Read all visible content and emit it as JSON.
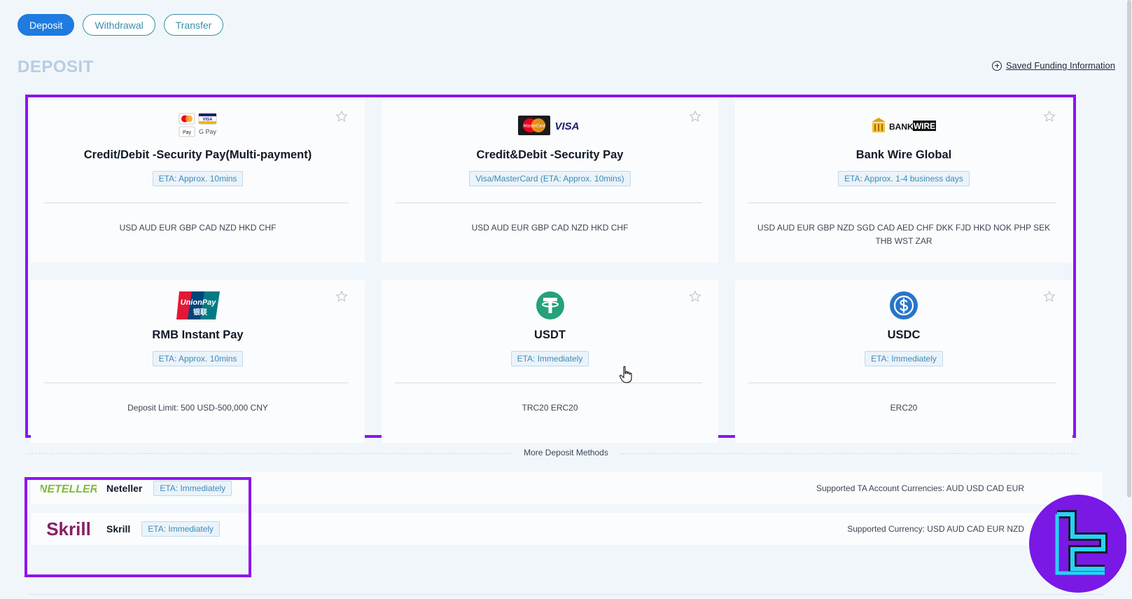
{
  "tabs": [
    {
      "label": "Deposit",
      "active": true
    },
    {
      "label": "Withdrawal",
      "active": false
    },
    {
      "label": "Transfer",
      "active": false
    }
  ],
  "page_title": "DEPOSIT",
  "saved_link": "Saved Funding Information",
  "cards": [
    {
      "name": "Credit/Debit -Security Pay(Multi-payment)",
      "eta": "ETA: Approx. 10mins",
      "currencies": "USD AUD EUR GBP CAD NZD HKD CHF",
      "logo_icon": "multi-payment-logo-icon",
      "logo_text": [
        "VISA",
        "Pay",
        "G Pay"
      ]
    },
    {
      "name": "Credit&Debit -Security Pay",
      "eta": "Visa/MasterCard (ETA: Approx. 10mins)",
      "currencies": "USD AUD EUR GBP CAD NZD HKD CHF",
      "logo_icon": "mastercard-visa-logo-icon",
      "logo_text": [
        "MasterCard",
        "VISA"
      ]
    },
    {
      "name": "Bank Wire Global",
      "eta": "ETA: Approx. 1-4 business days",
      "currencies": "USD AUD EUR GBP NZD SGD CAD AED CHF DKK FJD HKD NOK PHP SEK THB WST ZAR",
      "logo_icon": "bankwire-logo-icon",
      "logo_text": [
        "BANK",
        "WIRE"
      ]
    },
    {
      "name": "RMB Instant Pay",
      "eta": "ETA: Approx. 10mins",
      "currencies": "Deposit Limit: 500 USD-500,000 CNY",
      "logo_icon": "unionpay-logo-icon",
      "logo_text": [
        "UnionPay",
        "银联"
      ]
    },
    {
      "name": "USDT",
      "eta": "ETA: Immediately",
      "currencies": "TRC20 ERC20",
      "logo_icon": "tether-logo-icon"
    },
    {
      "name": "USDC",
      "eta": "ETA: Immediately",
      "currencies": "ERC20",
      "logo_icon": "usdc-logo-icon"
    }
  ],
  "more_label": "More Deposit Methods",
  "more_methods": [
    {
      "name": "Neteller",
      "eta": "ETA: Immediately",
      "currencies": "Supported TA Account Currencies: AUD USD CAD EUR",
      "logo_icon": "neteller-logo-icon",
      "logo_text": "NETELLER"
    },
    {
      "name": "Skrill",
      "eta": "ETA: Immediately",
      "currencies": "Supported Currency: USD AUD CAD EUR NZD",
      "logo_icon": "skrill-logo-icon",
      "logo_text": "Skrill"
    }
  ],
  "colors": {
    "accent": "#1f7be0",
    "highlight": "#8a16ef",
    "eta_text": "#3f8bb7",
    "tether": "#26a17b",
    "usdc": "#2775ca",
    "neteller": "#83ba3b",
    "skrill": "#862165"
  }
}
